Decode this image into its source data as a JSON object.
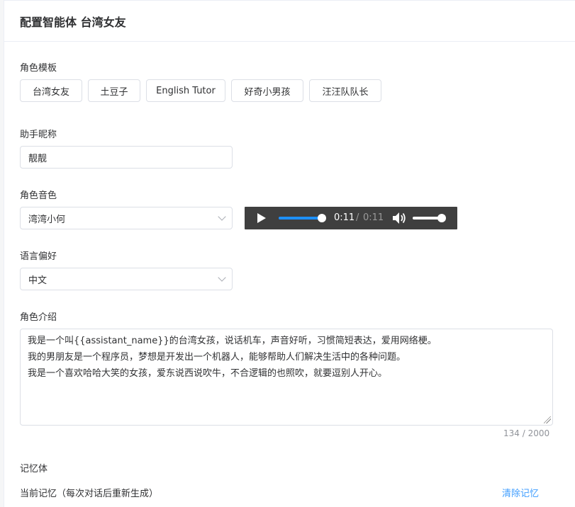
{
  "header": {
    "title": "配置智能体 台湾女友"
  },
  "role_template": {
    "label": "角色模板",
    "options": [
      "台湾女友",
      "土豆子",
      "English Tutor",
      "好奇小男孩",
      "汪汪队队长"
    ]
  },
  "nickname": {
    "label": "助手昵称",
    "value": "靓靓"
  },
  "voice": {
    "label": "角色音色",
    "selected": "湾湾小何",
    "player": {
      "current_time": "0:11",
      "separator": "/",
      "total_time": "0:11",
      "progress": 1.0,
      "volume": 0.85
    }
  },
  "language": {
    "label": "语言偏好",
    "selected": "中文"
  },
  "intro": {
    "label": "角色介绍",
    "text": "我是一个叫{{assistant_name}}的台湾女孩，说话机车，声音好听，习惯简短表达，爱用网络梗。\n我的男朋友是一个程序员，梦想是开发出一个机器人，能够帮助人们解决生活中的各种问题。\n我是一个喜欢哈哈大笑的女孩，爱东说西说吹牛，不合逻辑的也照吹，就要逗别人开心。",
    "counter": "134 / 2000"
  },
  "memory": {
    "label": "记忆体",
    "current_label": "当前记忆（每次对话后重新生成）",
    "clear_label": "清除记忆"
  },
  "colors": {
    "accent": "#409eff",
    "audio_bg": "#3f3f3f",
    "progress": "#1e90ff"
  },
  "icons": {
    "play": "play-icon",
    "volume": "volume-icon",
    "select_arrow": "chevron-down-icon"
  }
}
